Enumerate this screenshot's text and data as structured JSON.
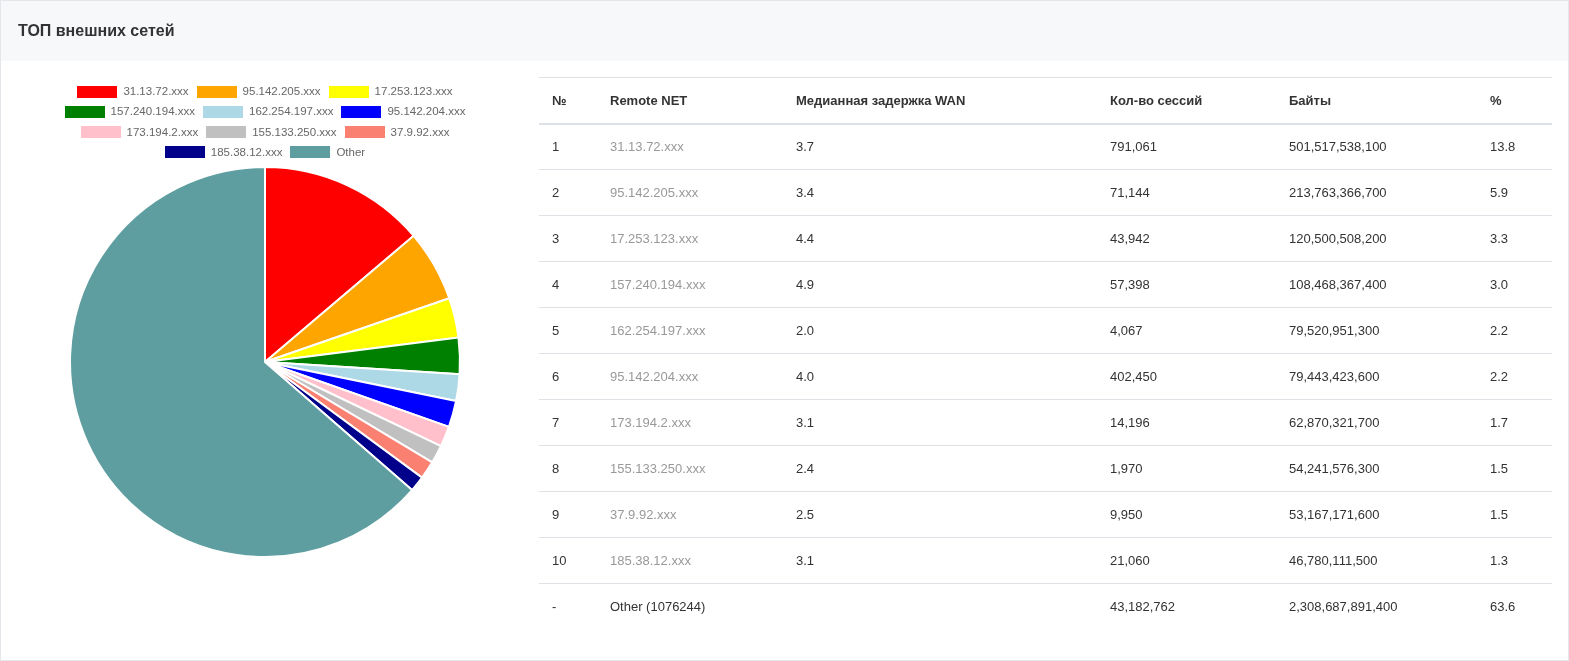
{
  "title": "ТОП внешних сетей",
  "chart": {
    "chart_data": {
      "type": "pie",
      "categories": [
        "31.13.72.xxx",
        "95.142.205.xxx",
        "17.253.123.xxx",
        "157.240.194.xxx",
        "162.254.197.xxx",
        "95.142.204.xxx",
        "173.194.2.xxx",
        "155.133.250.xxx",
        "37.9.92.xxx",
        "185.38.12.xxx",
        "Other"
      ],
      "series": [
        {
          "values": [
            13.8,
            5.9,
            3.3,
            3.0,
            2.2,
            2.2,
            1.7,
            1.5,
            1.5,
            1.3,
            63.6
          ],
          "colors": [
            "#ff0000",
            "#ffa500",
            "#ffff00",
            "#008000",
            "#add8e6",
            "#0000ff",
            "#ffc0cb",
            "#c0c0c0",
            "#fa8072",
            "#00008b",
            "#5f9ea0"
          ]
        }
      ]
    }
  },
  "table": {
    "columns": [
      "№",
      "Remote NET",
      "Медианная задержка WAN",
      "Кол-во сессий",
      "Байты",
      "%"
    ],
    "rows": [
      {
        "kind": "net",
        "cells": [
          "1",
          "31.13.72.xxx",
          "3.7",
          "791,061",
          "501,517,538,100",
          "13.8"
        ]
      },
      {
        "kind": "net",
        "cells": [
          "2",
          "95.142.205.xxx",
          "3.4",
          "71,144",
          "213,763,366,700",
          "5.9"
        ]
      },
      {
        "kind": "net",
        "cells": [
          "3",
          "17.253.123.xxx",
          "4.4",
          "43,942",
          "120,500,508,200",
          "3.3"
        ]
      },
      {
        "kind": "net",
        "cells": [
          "4",
          "157.240.194.xxx",
          "4.9",
          "57,398",
          "108,468,367,400",
          "3.0"
        ]
      },
      {
        "kind": "net",
        "cells": [
          "5",
          "162.254.197.xxx",
          "2.0",
          "4,067",
          "79,520,951,300",
          "2.2"
        ]
      },
      {
        "kind": "net",
        "cells": [
          "6",
          "95.142.204.xxx",
          "4.0",
          "402,450",
          "79,443,423,600",
          "2.2"
        ]
      },
      {
        "kind": "net",
        "cells": [
          "7",
          "173.194.2.xxx",
          "3.1",
          "14,196",
          "62,870,321,700",
          "1.7"
        ]
      },
      {
        "kind": "net",
        "cells": [
          "8",
          "155.133.250.xxx",
          "2.4",
          "1,970",
          "54,241,576,300",
          "1.5"
        ]
      },
      {
        "kind": "net",
        "cells": [
          "9",
          "37.9.92.xxx",
          "2.5",
          "9,950",
          "53,167,171,600",
          "1.5"
        ]
      },
      {
        "kind": "net",
        "cells": [
          "10",
          "185.38.12.xxx",
          "3.1",
          "21,060",
          "46,780,111,500",
          "1.3"
        ]
      },
      {
        "kind": "other",
        "cells": [
          "-",
          "Other (1076244)",
          "",
          "43,182,762",
          "2,308,687,891,400",
          "63.6"
        ]
      }
    ]
  }
}
